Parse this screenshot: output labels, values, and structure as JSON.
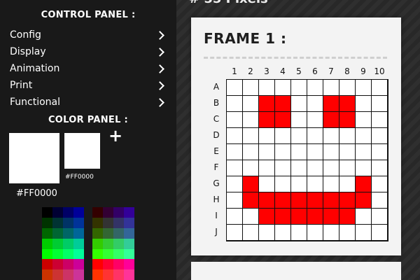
{
  "header": {
    "title": "# 55 Pixels"
  },
  "control_panel": {
    "title": "CONTROL PANEL :",
    "items": [
      {
        "label": "Config"
      },
      {
        "label": "Display"
      },
      {
        "label": "Animation"
      },
      {
        "label": "Print"
      },
      {
        "label": "Functional"
      }
    ]
  },
  "color_panel": {
    "title": "COLOR PANEL :",
    "primary_color": "#FFFFFF",
    "primary_hex": "#FF0000",
    "secondary_color": "#FFFFFF",
    "secondary_hex": "#FF0000",
    "add_icon": "plus-icon",
    "palettes": [
      [
        "#000000",
        "#000033",
        "#000066",
        "#000099",
        "#003300",
        "#003333",
        "#003366",
        "#003399",
        "#006600",
        "#006633",
        "#006666",
        "#006699",
        "#00CC00",
        "#00CC33",
        "#00CC66",
        "#00CC99",
        "#00FF00",
        "#00FF33",
        "#00FF66",
        "#00FF99"
      ],
      [
        "#330000",
        "#330033",
        "#330066",
        "#330099",
        "#333300",
        "#333333",
        "#333366",
        "#333399",
        "#336600",
        "#336633",
        "#336666",
        "#336699",
        "#33CC00",
        "#33CC33",
        "#33CC66",
        "#33CC99",
        "#33FF00",
        "#33FF33",
        "#33FF66",
        "#33FF99"
      ],
      [
        "#CC0000",
        "#CC0033",
        "#CC0066",
        "#CC0099",
        "#CC3300",
        "#CC3333",
        "#CC3366",
        "#CC3399"
      ],
      [
        "#FF0000",
        "#FF0033",
        "#FF0066",
        "#FF0099",
        "#FF3300",
        "#FF3333",
        "#FF3366",
        "#FF3399"
      ]
    ]
  },
  "frame": {
    "title": "FRAME 1 :",
    "columns": [
      "1",
      "2",
      "3",
      "4",
      "5",
      "6",
      "7",
      "8",
      "9",
      "10"
    ],
    "rows": [
      "A",
      "B",
      "C",
      "D",
      "E",
      "F",
      "G",
      "H",
      "I",
      "J"
    ],
    "fill_color": "#FF0000",
    "empty_color": "#FFFFFF",
    "filled_cells": [
      "B3",
      "B4",
      "B7",
      "B8",
      "C3",
      "C4",
      "C7",
      "C8",
      "G2",
      "G9",
      "H2",
      "H3",
      "H4",
      "H5",
      "H6",
      "H7",
      "H8",
      "H9",
      "I3",
      "I4",
      "I5",
      "I6",
      "I7",
      "I8"
    ]
  }
}
